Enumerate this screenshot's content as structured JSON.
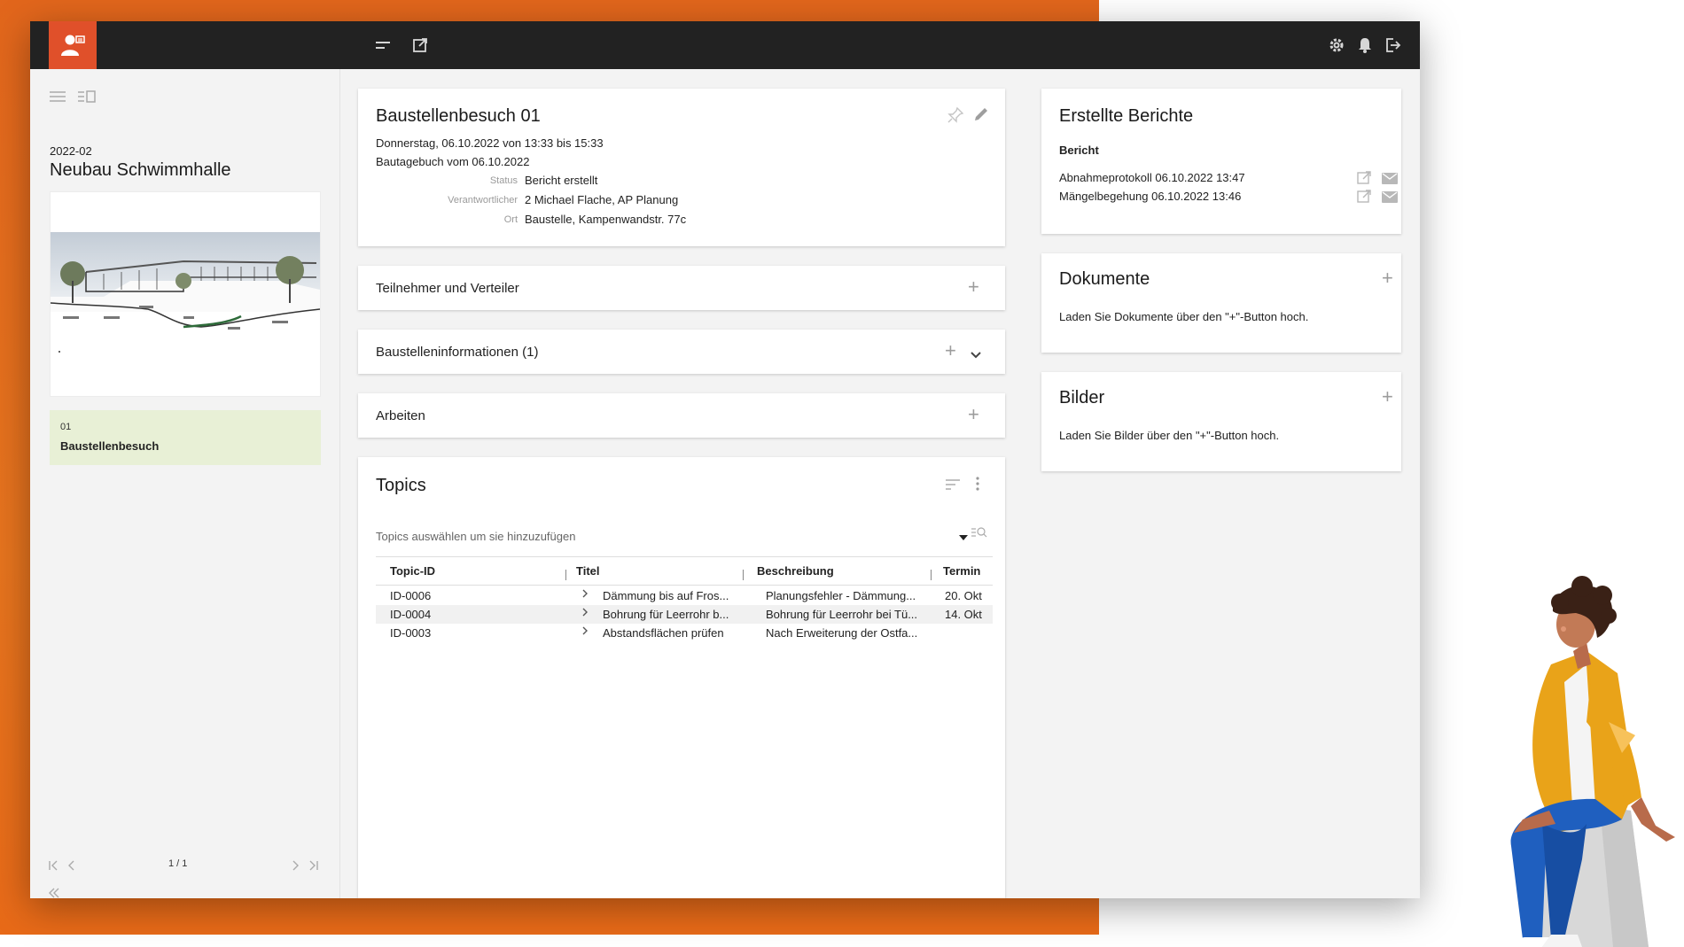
{
  "project": {
    "code": "2022-02",
    "name": "Neubau Schwimmhalle"
  },
  "left_list": [
    {
      "number": "01",
      "title": "Baustellenbesuch"
    }
  ],
  "pagination": {
    "label": "1 / 1"
  },
  "visit": {
    "title": "Baustellenbesuch 01",
    "date_line": "Donnerstag, 06.10.2022 von 13:33 bis 15:33",
    "diary_line": "Bautagebuch vom 06.10.2022",
    "fields": [
      {
        "label": "Status",
        "value": "Bericht erstellt"
      },
      {
        "label": "Verantwortlicher",
        "value": "2 Michael Flache, AP Planung"
      },
      {
        "label": "Ort",
        "value": "Baustelle, Kampenwandstr. 77c"
      }
    ]
  },
  "sections": {
    "participants": "Teilnehmer und Verteiler",
    "site_info": "Baustelleninformationen (1)",
    "works": "Arbeiten"
  },
  "topics": {
    "title": "Topics",
    "select_placeholder": "Topics auswählen um sie hinzuzufügen",
    "columns": [
      "Topic-ID",
      "Titel",
      "Beschreibung",
      "Termin"
    ],
    "rows": [
      {
        "id": "ID-0006",
        "title": "Dämmung bis auf Fros...",
        "desc": "Planungsfehler - Dämmung...",
        "date": "20. Okt"
      },
      {
        "id": "ID-0004",
        "title": "Bohrung für Leerrohr b...",
        "desc": "Bohrung für Leerrohr bei Tü...",
        "date": "14. Okt"
      },
      {
        "id": "ID-0003",
        "title": "Abstandsflächen prüfen",
        "desc": "Nach Erweiterung der Ostfa...",
        "date": ""
      }
    ]
  },
  "reports": {
    "title": "Erstellte Berichte",
    "subheading": "Bericht",
    "items": [
      {
        "label": "Abnahmeprotokoll 06.10.2022 13:47"
      },
      {
        "label": "Mängelbegehung 06.10.2022 13:46"
      }
    ]
  },
  "documents": {
    "title": "Dokumente",
    "hint": "Laden Sie Dokumente über den \"+\"-Button hoch."
  },
  "images": {
    "title": "Bilder",
    "hint": "Laden Sie Bilder über den \"+\"-Button hoch."
  },
  "colors": {
    "accent": "#e0502a",
    "topbar": "#222222",
    "selected_item": "#e8f0d6",
    "background_orange": "#e36a1c"
  }
}
